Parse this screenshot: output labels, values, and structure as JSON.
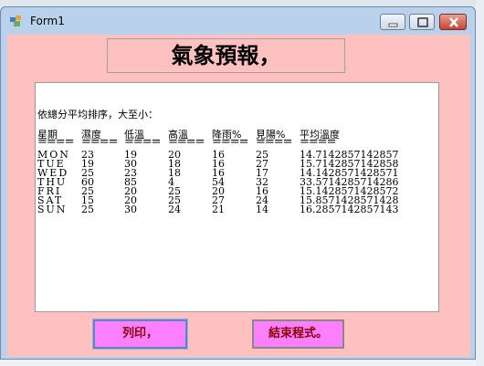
{
  "window": {
    "title": "Form1"
  },
  "form": {
    "heading": "氣象預報，",
    "buttons": {
      "print": "列印，",
      "exit": "結束程式。"
    }
  },
  "report": {
    "title": "依總分平均排序，大至小：",
    "headers": [
      "星期",
      "濕度",
      "低溫",
      "高溫",
      "降雨%",
      "見陽%",
      "平均溫度"
    ],
    "underline": "====",
    "rows": [
      [
        "MON",
        "23",
        "19",
        "20",
        "16",
        "25",
        "14.7142857142857"
      ],
      [
        "TUE",
        "19",
        "30",
        "18",
        "16",
        "27",
        "15.7142857142858"
      ],
      [
        "WED",
        "25",
        "23",
        "18",
        "16",
        "17",
        "14.1428571428571"
      ],
      [
        "THU",
        "60",
        "85",
        "4",
        "54",
        "32",
        "33.5714285714286"
      ],
      [
        "FRI",
        "25",
        "20",
        "25",
        "20",
        "16",
        "15.1428571428572"
      ],
      [
        "SAT",
        "15",
        "20",
        "25",
        "27",
        "24",
        "15.8571428571428"
      ],
      [
        "SUN",
        "25",
        "30",
        "24",
        "21",
        "14",
        "16.2857142857143"
      ]
    ]
  },
  "colors": {
    "form_bg": "#ffc0c0",
    "button_bg": "#ff80ff",
    "button_text": "#8b0000"
  }
}
